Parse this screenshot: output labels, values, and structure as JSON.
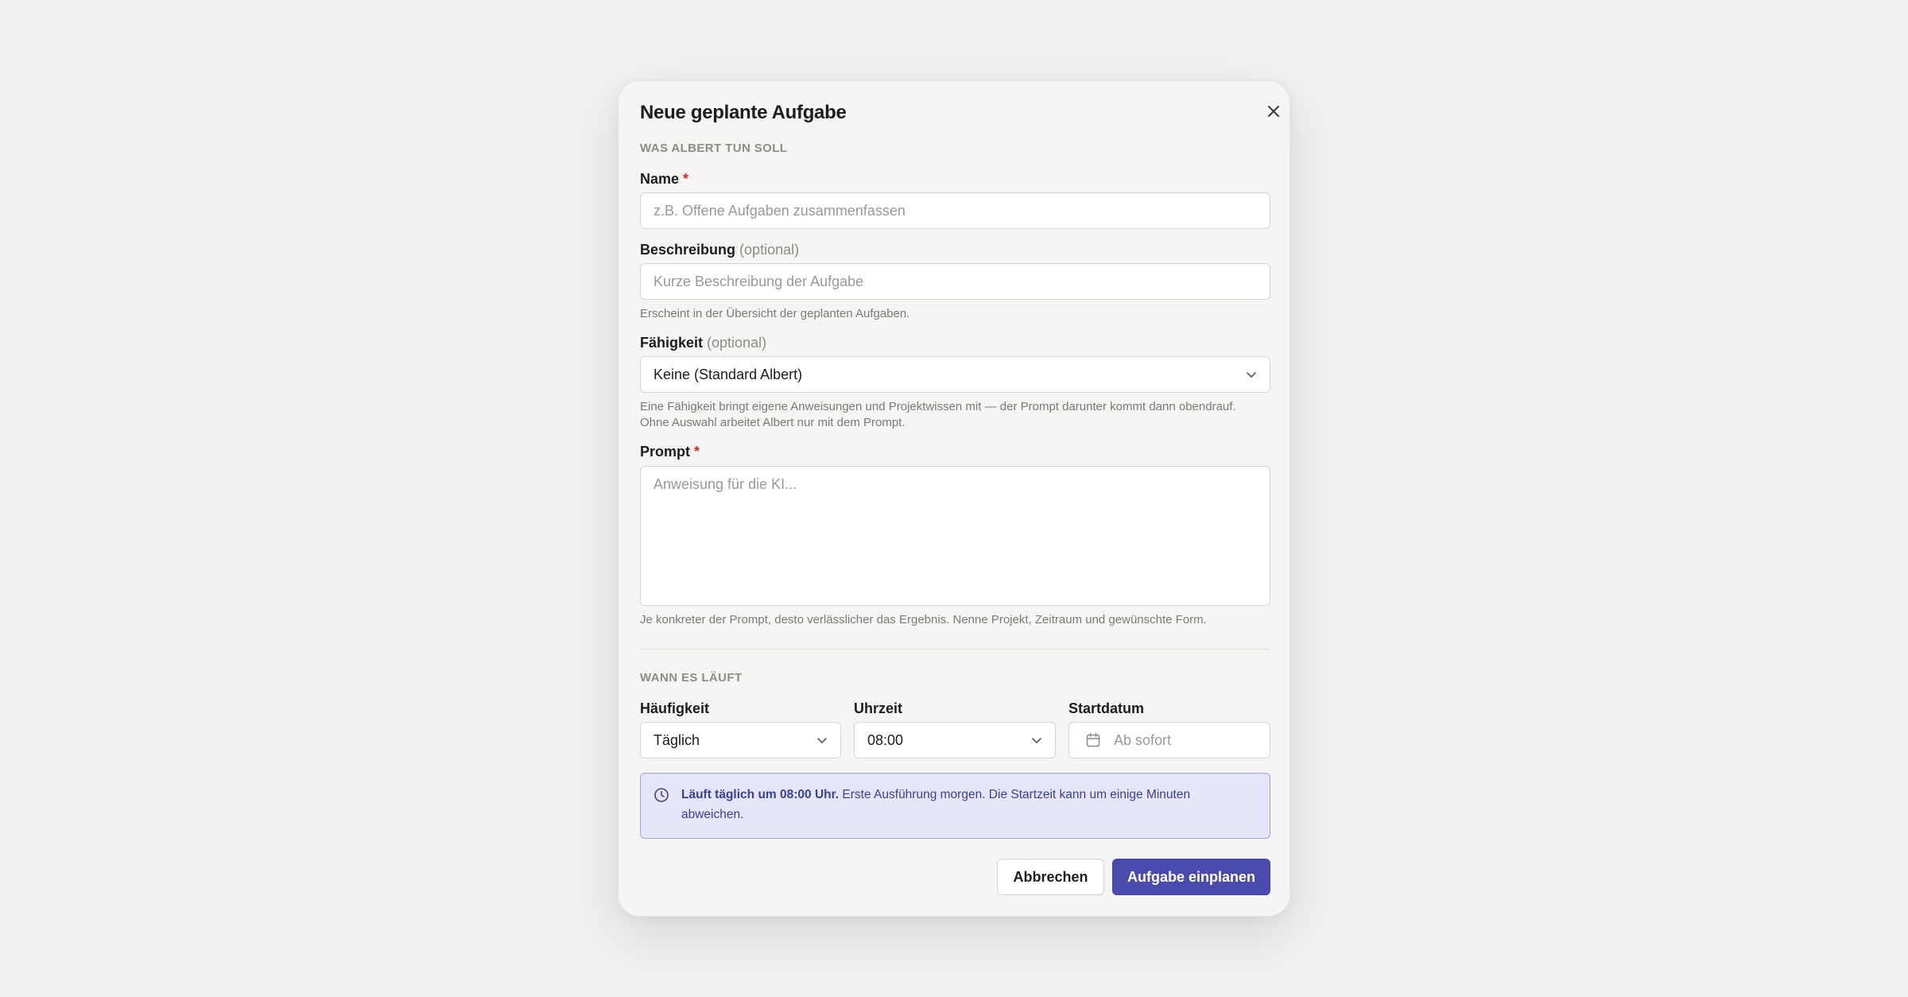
{
  "dialog": {
    "title": "Neue geplante Aufgabe",
    "close_icon": "close-icon"
  },
  "section_what": {
    "label": "WAS ALBERT TUN SOLL",
    "name": {
      "label": "Name",
      "required_mark": "*",
      "placeholder": "z.B. Offene Aufgaben zusammenfassen"
    },
    "description": {
      "label": "Beschreibung",
      "optional": "(optional)",
      "placeholder": "Kurze Beschreibung der Aufgabe",
      "hint": "Erscheint in der Übersicht der geplanten Aufgaben."
    },
    "skill": {
      "label": "Fähigkeit",
      "optional": "(optional)",
      "value": "Keine (Standard Albert)",
      "hint_line1": "Eine Fähigkeit bringt eigene Anweisungen und Projektwissen mit — der Prompt darunter kommt dann obendrauf.",
      "hint_line2": "Ohne Auswahl arbeitet Albert nur mit dem Prompt."
    },
    "prompt": {
      "label": "Prompt",
      "required_mark": "*",
      "placeholder": "Anweisung für die KI...",
      "hint": "Je konkreter der Prompt, desto verlässlicher das Ergebnis. Nenne Projekt, Zeitraum und gewünschte Form."
    }
  },
  "section_when": {
    "label": "WANN ES LÄUFT",
    "frequency": {
      "label": "Häufigkeit",
      "value": "Täglich"
    },
    "time": {
      "label": "Uhrzeit",
      "value": "08:00"
    },
    "start_date": {
      "label": "Startdatum",
      "placeholder": "Ab sofort",
      "icon": "calendar-icon"
    }
  },
  "info": {
    "icon": "clock-icon",
    "bold": "Läuft täglich um 08:00 Uhr.",
    "text": "Erste Ausführung morgen. Die Startzeit kann um einige Minuten abweichen.",
    "colors": {
      "background": "#e5e6f9",
      "border": "#9da0e6",
      "text": "#3b3f96"
    }
  },
  "actions": {
    "cancel": "Abbrechen",
    "submit": "Aufgabe einplanen",
    "accent_color": "#4b4bae"
  }
}
